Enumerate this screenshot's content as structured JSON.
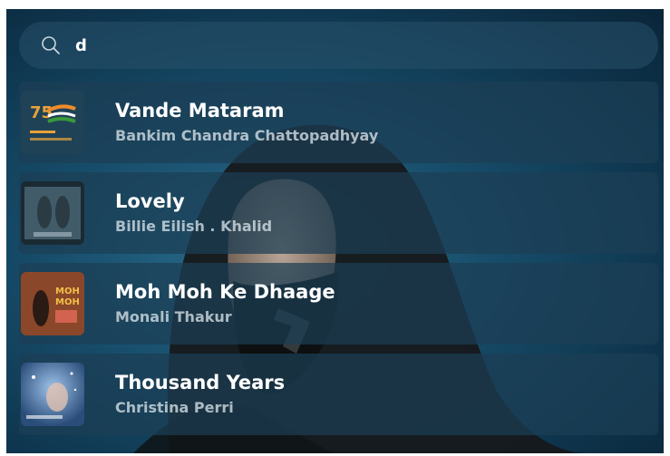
{
  "search": {
    "value": "d",
    "icon": "search-icon"
  },
  "results": [
    {
      "title": "Vande Mataram",
      "artist": "Bankim Chandra Chattopadhyay",
      "thumb_icon": "azadi-ka-amrit-mahotsav-logo"
    },
    {
      "title": "Lovely",
      "artist": "Billie Eilish . Khalid",
      "thumb_icon": "lovely-album-art"
    },
    {
      "title": "Moh Moh Ke Dhaage",
      "artist": "Monali Thakur",
      "thumb_icon": "moh-moh-album-art"
    },
    {
      "title": "Thousand Years",
      "artist": "Christina Perri",
      "thumb_icon": "thousand-years-album-art"
    }
  ],
  "colors": {
    "background": "#174d6a",
    "row": "#1c3e54",
    "text_primary": "#ffffff",
    "text_secondary": "#d7e1e8"
  }
}
